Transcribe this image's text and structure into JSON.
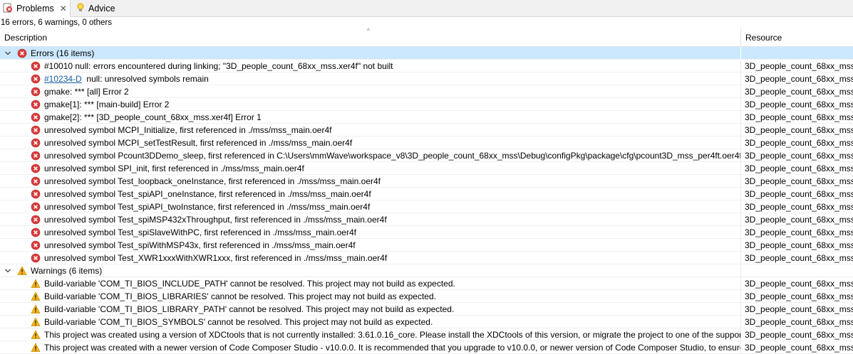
{
  "tabs": [
    {
      "label": "Problems",
      "icon": "problems-icon",
      "active": true
    },
    {
      "label": "Advice",
      "icon": "lightbulb-icon",
      "active": false
    }
  ],
  "summary": "16 errors, 6 warnings, 0 others",
  "columns": {
    "description": "Description",
    "resource": "Resource"
  },
  "colors": {
    "error": "#d93b3b",
    "warning": "#f2b320",
    "selection": "#cce8ff",
    "link": "#1a5ea8"
  },
  "groups": [
    {
      "label": "Errors (16 items)",
      "kind": "error",
      "items": [
        {
          "code": "",
          "text": "#10010 null: errors encountered during linking; \"3D_people_count_68xx_mss.xer4f\" not built",
          "resource": "3D_people_count_68xx_mss"
        },
        {
          "code": "#10234-D",
          "text": "null: unresolved symbols remain",
          "resource": "3D_people_count_68xx_mss"
        },
        {
          "code": "",
          "text": "gmake: *** [all] Error 2",
          "resource": "3D_people_count_68xx_mss"
        },
        {
          "code": "",
          "text": "gmake[1]: *** [main-build] Error 2",
          "resource": "3D_people_count_68xx_mss"
        },
        {
          "code": "",
          "text": "gmake[2]: *** [3D_people_count_68xx_mss.xer4f] Error 1",
          "resource": "3D_people_count_68xx_mss"
        },
        {
          "code": "",
          "text": "unresolved symbol MCPI_Initialize, first referenced in ./mss/mss_main.oer4f",
          "resource": "3D_people_count_68xx_mss"
        },
        {
          "code": "",
          "text": "unresolved symbol MCPI_setTestResult, first referenced in ./mss/mss_main.oer4f",
          "resource": "3D_people_count_68xx_mss"
        },
        {
          "code": "",
          "text": "unresolved symbol Pcount3DDemo_sleep, first referenced in C:\\Users\\mmWave\\workspace_v8\\3D_people_count_68xx_mss\\Debug\\configPkg\\package\\cfg\\pcount3D_mss_per4ft.oer4ft",
          "resource": "3D_people_count_68xx_mss"
        },
        {
          "code": "",
          "text": "unresolved symbol SPI_init, first referenced in ./mss/mss_main.oer4f",
          "resource": "3D_people_count_68xx_mss"
        },
        {
          "code": "",
          "text": "unresolved symbol Test_loopback_oneInstance, first referenced in ./mss/mss_main.oer4f",
          "resource": "3D_people_count_68xx_mss"
        },
        {
          "code": "",
          "text": "unresolved symbol Test_spiAPI_oneInstance, first referenced in ./mss/mss_main.oer4f",
          "resource": "3D_people_count_68xx_mss"
        },
        {
          "code": "",
          "text": "unresolved symbol Test_spiAPI_twoInstance, first referenced in ./mss/mss_main.oer4f",
          "resource": "3D_people_count_68xx_mss"
        },
        {
          "code": "",
          "text": "unresolved symbol Test_spiMSP432xThroughput, first referenced in ./mss/mss_main.oer4f",
          "resource": "3D_people_count_68xx_mss"
        },
        {
          "code": "",
          "text": "unresolved symbol Test_spiSlaveWithPC, first referenced in ./mss/mss_main.oer4f",
          "resource": "3D_people_count_68xx_mss"
        },
        {
          "code": "",
          "text": "unresolved symbol Test_spiWithMSP43x, first referenced in ./mss/mss_main.oer4f",
          "resource": "3D_people_count_68xx_mss"
        },
        {
          "code": "",
          "text": "unresolved symbol Test_XWR1xxxWithXWR1xxx, first referenced in ./mss/mss_main.oer4f",
          "resource": "3D_people_count_68xx_mss"
        }
      ]
    },
    {
      "label": "Warnings (6 items)",
      "kind": "warning",
      "items": [
        {
          "code": "",
          "text": "Build-variable 'COM_TI_BIOS_INCLUDE_PATH' cannot be resolved. This project may not build as expected.",
          "resource": "3D_people_count_68xx_mss"
        },
        {
          "code": "",
          "text": "Build-variable 'COM_TI_BIOS_LIBRARIES' cannot be resolved. This project may not build as expected.",
          "resource": "3D_people_count_68xx_mss"
        },
        {
          "code": "",
          "text": "Build-variable 'COM_TI_BIOS_LIBRARY_PATH' cannot be resolved. This project may not build as expected.",
          "resource": "3D_people_count_68xx_mss"
        },
        {
          "code": "",
          "text": "Build-variable 'COM_TI_BIOS_SYMBOLS' cannot be resolved. This project may not build as expected.",
          "resource": "3D_people_count_68xx_mss"
        },
        {
          "code": "",
          "text": "This project was created using a version of XDCtools that is not currently installed: 3.61.0.16_core. Please install the XDCtools of this version, or migrate the project to one of the supported",
          "resource": "3D_people_count_68xx_mss"
        },
        {
          "code": "",
          "text": "This project was created with a newer version of Code Composer Studio - v10.0.0. It is recommended that you upgrade to v10.0.0, or newer version of Code Composer Studio, to ensure op",
          "resource": "3D_people_count_68xx_mss"
        }
      ]
    }
  ]
}
